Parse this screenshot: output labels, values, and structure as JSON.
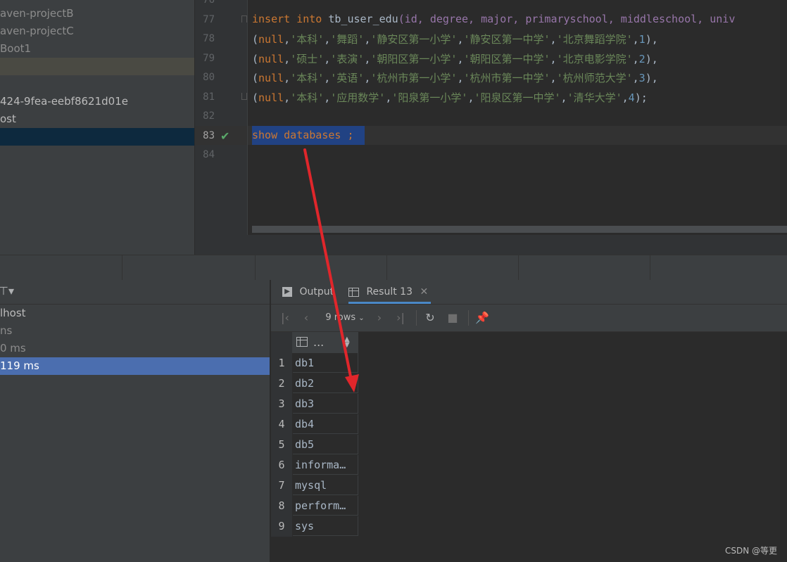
{
  "project_tree": {
    "rows": [
      "aven-projectB",
      "aven-projectC",
      "Boot1",
      "",
      "",
      "424-9fea-eebf8621d01e",
      "ost",
      ""
    ]
  },
  "editor": {
    "line_numbers": [
      "77",
      "78",
      "79",
      "80",
      "81",
      "82",
      "83",
      "84"
    ],
    "current_line": "83",
    "line77": {
      "kw1": "insert",
      "kw2": "into",
      "table": "tb_user_edu",
      "cols": "(id, degree, major, primaryschool, middleschool, univ"
    },
    "rows": [
      {
        "v": [
          "'本科'",
          "'舞蹈'",
          "'静安区第一小学'",
          "'静安区第一中学'",
          "'北京舞蹈学院'"
        ],
        "id": "1",
        "end": "),"
      },
      {
        "v": [
          "'硕士'",
          "'表演'",
          "'朝阳区第一小学'",
          "'朝阳区第一中学'",
          "'北京电影学院'"
        ],
        "id": "2",
        "end": "),"
      },
      {
        "v": [
          "'本科'",
          "'英语'",
          "'杭州市第一小学'",
          "'杭州市第一中学'",
          "'杭州师范大学'"
        ],
        "id": "3",
        "end": "),"
      },
      {
        "v": [
          "'本科'",
          "'应用数学'",
          "'阳泉第一小学'",
          "'阳泉区第一中学'",
          "'清华大学'"
        ],
        "id": "4",
        "end": ");"
      }
    ],
    "null_kw": "null",
    "line83": "show databases ;"
  },
  "services": {
    "rows": [
      "lhost",
      "ns",
      "0 ms",
      "119 ms"
    ]
  },
  "result": {
    "tabs": {
      "output": "Output",
      "result": "Result 13"
    },
    "rows_label": "9 rows",
    "column_header": "...",
    "row_numbers": [
      "1",
      "2",
      "3",
      "4",
      "5",
      "6",
      "7",
      "8",
      "9"
    ],
    "values": [
      "db1",
      "db2",
      "db3",
      "db4",
      "db5",
      "informa…",
      "mysql",
      "perform…",
      "sys"
    ]
  },
  "watermark": "CSDN @等更",
  "colors": {
    "accent": "#4b6eaf",
    "arrow": "#e0262b",
    "selection": "#214283",
    "check": "#59a869"
  }
}
